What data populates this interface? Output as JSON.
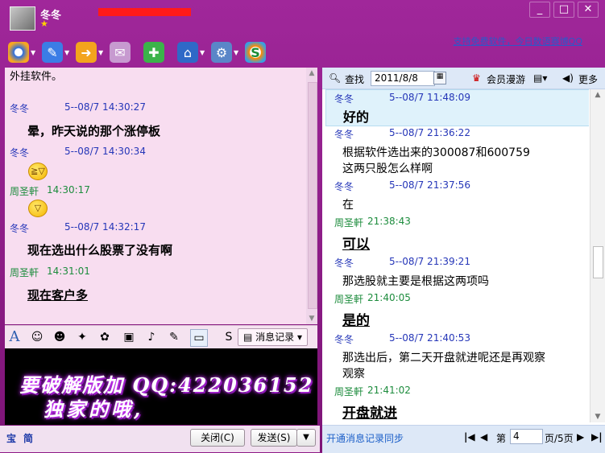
{
  "titlebar": {
    "nickname": "冬冬",
    "win_buttons": [
      "_",
      "□",
      "✕"
    ]
  },
  "promo_link": "支持免费软件，今日数语赛博QQ",
  "toolbar": {
    "icons": [
      "video-icon",
      "voice-icon",
      "file-transfer-icon",
      "mail-icon",
      "add-app-icon",
      "remote-assist-icon",
      "settings-icon",
      "soso-icon"
    ]
  },
  "left_chat": {
    "top_fragment": "外挂软件。",
    "messages": [
      {
        "sender": "冬冬",
        "meta": "5--08/7  14:30:27",
        "text": "晕，昨天说的那个涨停板"
      },
      {
        "sender": "冬冬",
        "meta": "5--08/7  14:30:34",
        "emoji": "laughing-emoji-icon"
      },
      {
        "sender": "周圣軒",
        "meta": "14:30:17",
        "emoji": "grin-emoji-icon"
      },
      {
        "sender": "冬冬",
        "meta": "5--08/7  14:32:17",
        "text": "现在选出什么股票了没有啊"
      },
      {
        "sender": "周圣軒",
        "meta": "14:31:01",
        "text": "现在客户多"
      }
    ]
  },
  "input_toolbar": {
    "message_record_label": "消息记录"
  },
  "input_area": {
    "line1": "要破解版加 QQ:422036152",
    "line2": "独家的哦,"
  },
  "left_bottom": {
    "quick1": "宝",
    "quick2": "简",
    "close_label": "关闭(C)",
    "send_label": "发送(S)"
  },
  "right_panel": {
    "search_label": "查找",
    "date_value": "2011/8/8",
    "member_label": "会员漫游",
    "more_label": "更多",
    "history": [
      {
        "sender": "冬冬",
        "meta": "5--08/7 11:48:09",
        "lines": [
          "好的"
        ],
        "style": "bold-plain"
      },
      {
        "sender": "冬冬",
        "meta": "5--08/7 21:36:22",
        "lines": [
          "根据软件选出来的300087和600759",
          "这两只股怎么样啊"
        ],
        "style": "normal"
      },
      {
        "sender": "冬冬",
        "meta": "5--08/7 21:37:56",
        "lines": [
          "在"
        ],
        "style": "normal"
      },
      {
        "sender": "周圣軒",
        "meta": "21:38:43",
        "lines": [
          "可以"
        ],
        "style": "bold"
      },
      {
        "sender": "冬冬",
        "meta": "5--08/7 21:39:21",
        "lines": [
          "那选股就主要是根据这两项吗"
        ],
        "style": "normal"
      },
      {
        "sender": "周圣軒",
        "meta": "21:40:05",
        "lines": [
          "是的"
        ],
        "style": "bold"
      },
      {
        "sender": "冬冬",
        "meta": "5--08/7 21:40:53",
        "lines": [
          "那选出后，第二天开盘就进呢还是再观察",
          "观察"
        ],
        "style": "normal"
      },
      {
        "sender": "周圣軒",
        "meta": "21:41:02",
        "lines": [
          "开盘就进"
        ],
        "style": "bold"
      }
    ],
    "sync_label": "开通消息记录同步",
    "page_prefix": "第",
    "page_value": "4",
    "page_suffix": "页/5页"
  },
  "colors": {
    "frame": "#8e1a86",
    "chat_bg": "#f8ddf0",
    "sender_blue": "#2536b8",
    "sender_green": "#1d8c3d"
  }
}
